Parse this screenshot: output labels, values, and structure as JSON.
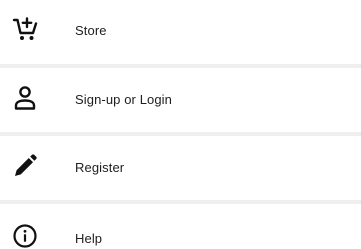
{
  "menu": {
    "items": [
      {
        "label": "Store",
        "icon": "cart-plus-icon"
      },
      {
        "label": "Sign-up or Login",
        "icon": "person-icon"
      },
      {
        "label": "Register",
        "icon": "pencil-icon"
      },
      {
        "label": "Help",
        "icon": "info-icon"
      }
    ]
  },
  "colors": {
    "icon": "#111111",
    "text": "#202020",
    "divider": "#efefef",
    "background": "#ffffff"
  }
}
